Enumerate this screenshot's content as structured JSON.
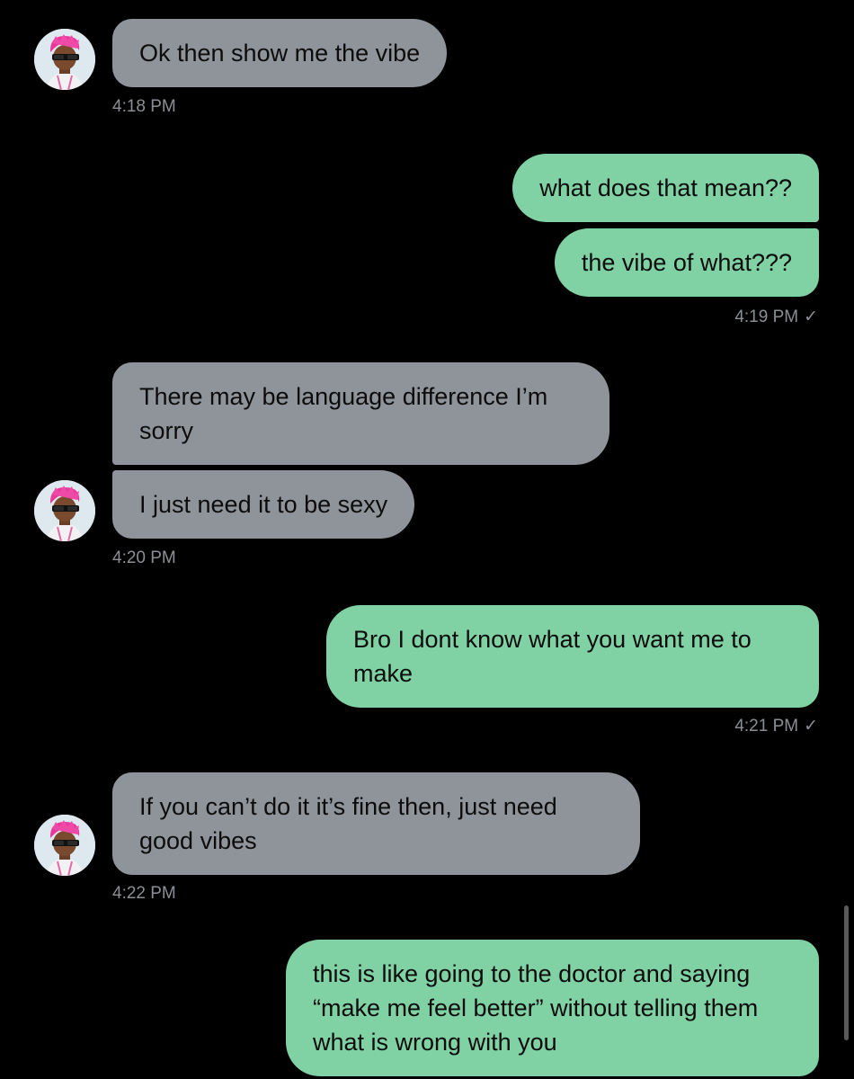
{
  "colors": {
    "background": "#000000",
    "incoming_bubble": "#8f949b",
    "outgoing_bubble": "#80d2a4",
    "timestamp": "#8b8f94"
  },
  "icons": {
    "avatar": "user-avatar-icon",
    "read_receipt": "checkmark-icon"
  },
  "conversation": {
    "messages": [
      {
        "direction": "incoming",
        "text": "Ok then show me the vibe"
      },
      {
        "direction": "outgoing",
        "text": "what does that mean??"
      },
      {
        "direction": "outgoing",
        "text": "the vibe of what???"
      },
      {
        "direction": "incoming",
        "text": "There may be language difference I’m sorry"
      },
      {
        "direction": "incoming",
        "text": "I just need it to be sexy"
      },
      {
        "direction": "outgoing",
        "text": "Bro I dont know what you want me to make"
      },
      {
        "direction": "incoming",
        "text": "If you can’t do it it’s fine then, just need good vibes"
      },
      {
        "direction": "outgoing",
        "text": "this is like going to the doctor and saying “make me feel better” without telling them what is wrong with you"
      }
    ],
    "timestamps": [
      {
        "text": "4:18 PM"
      },
      {
        "text": "4:19 PM",
        "read_mark": "✓"
      },
      {
        "text": "4:20 PM"
      },
      {
        "text": "4:21 PM",
        "read_mark": "✓"
      },
      {
        "text": "4:22 PM"
      }
    ]
  }
}
